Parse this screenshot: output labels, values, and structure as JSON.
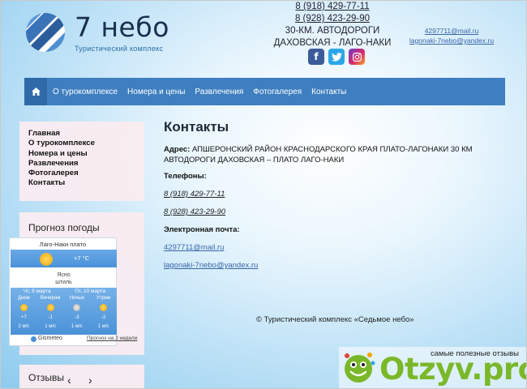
{
  "header": {
    "brand": "7 небо",
    "tagline": "Туристический комплекс",
    "phones": [
      "8 (918) 429-77-11",
      "8 (928) 423-29-90"
    ],
    "location_line1": "30-КМ. АВТОДОРОГИ",
    "location_line2": "ДАХОВСКАЯ - ЛАГО-НАКИ",
    "emails": [
      "4297711@mail.ru",
      "lagonaki-7nebo@yandex.ru"
    ],
    "socials": [
      {
        "name": "facebook",
        "glyph": "f",
        "color": "#3b5b9a"
      },
      {
        "name": "twitter",
        "glyph": "t",
        "color": "#2ba6e8"
      },
      {
        "name": "instagram",
        "glyph": "◎",
        "color": "#d6296b"
      }
    ]
  },
  "nav": {
    "home_icon": "home-icon",
    "items": [
      "О турокомплексе",
      "Номера и цены",
      "Развлечения",
      "Фотогалерея",
      "Контакты"
    ]
  },
  "sidebar": {
    "menu": [
      "Главная",
      "О турокомплексе",
      "Номера и цены",
      "Развлечения",
      "Фотогалерея",
      "Контакты"
    ],
    "weather_title": "Прогноз погоды",
    "weather": {
      "place": "Лаго-Наки плато",
      "now_temp": "+7 °C",
      "desc1": "Ясно",
      "desc2": "штиль",
      "days": [
        "Чт, 9 марта",
        "Пт, 10 марта"
      ],
      "periods": [
        {
          "label": "Днем",
          "temp": "+7",
          "wind": "2 м/с",
          "icon": "sun-icon"
        },
        {
          "label": "Вечером",
          "temp": "-1",
          "wind": "1 м/с",
          "icon": "sun-icon"
        },
        {
          "label": "Ночью",
          "temp": "-3",
          "wind": "1 м/с",
          "icon": "moon-icon"
        },
        {
          "label": "Утром",
          "temp": "-2",
          "wind": "1 м/с",
          "icon": "sun-icon"
        }
      ],
      "provider": "Gismeteo",
      "forecast_link": "Прогноз на 2 недели"
    },
    "reviews_title": "Отзывы",
    "reviews_prev": "‹",
    "reviews_next": "›"
  },
  "main": {
    "title": "Контакты",
    "address_label": "Адрес:",
    "address_text": " АПШЕРОНСКИЙ РАЙОН КРАСНОДАРСКОГО КРАЯ ПЛАТО-ЛАГОНАКИ 30 КМ АВТОДОРОГИ ДАХОВСКАЯ – ПЛАТО ЛАГО-НАКИ",
    "phones_label": "Телефоны:",
    "phones": [
      "8 (918) 429-77-11",
      "8 (928) 423-29-90"
    ],
    "email_label": "Электронная почта:",
    "emails": [
      "4297711@mail.ru",
      "lagonaki-7nebo@yandex.ru"
    ],
    "copyright": "© Туристический комплекс «Седьмое небо»"
  },
  "watermark": {
    "tagline": "самые полезные отзывы",
    "brand": "Otzyv.pro",
    "accent": "#7ab82a"
  },
  "colors": {
    "nav_bg": "#3f7fc0",
    "nav_home_bg": "#2f6aa8",
    "sidebar_bg": "#faecf0",
    "link": "#3a66a8"
  }
}
